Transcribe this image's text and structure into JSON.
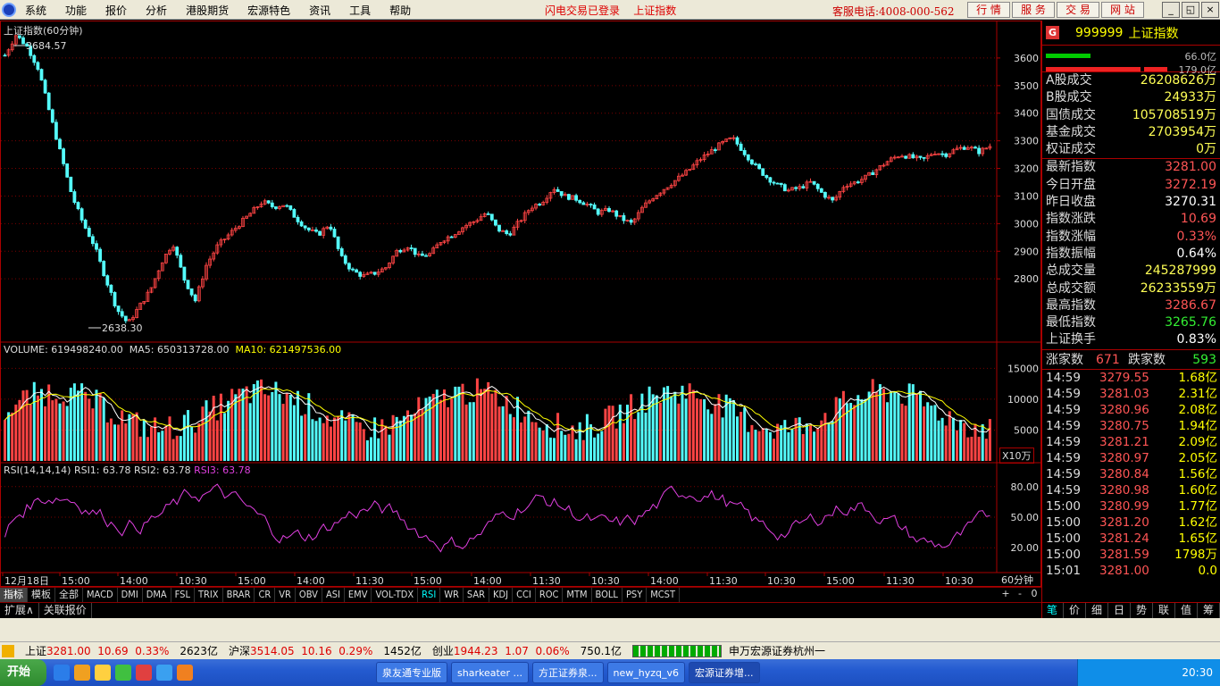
{
  "menubar": {
    "items": [
      "系统",
      "功能",
      "报价",
      "分析",
      "港股期货",
      "宏源特色",
      "资讯",
      "工具",
      "帮助"
    ],
    "status": "闪电交易已登录",
    "index_name": "上证指数",
    "phone": "客服电话:4008-000-562",
    "quick_buttons": [
      "行 情",
      "服 务",
      "交 易",
      "网 站"
    ],
    "window_buttons": [
      "_",
      "◱",
      "×"
    ]
  },
  "chart": {
    "title": "上证指数(60分钟)",
    "high_label": "3684.57",
    "low_label": "2638.30",
    "price_ticks": [
      "3600",
      "3500",
      "3400",
      "3300",
      "3200",
      "3100",
      "3000",
      "2900",
      "2800"
    ],
    "volume_header": "VOLUME: 619498240.00",
    "ma5_header": "MA5: 650313728.00",
    "ma10_header": "MA10: 621497536.00",
    "volume_ticks": [
      "15000",
      "10000",
      "5000"
    ],
    "volume_unit": "X10万",
    "rsi_header": "RSI(14,14,14)",
    "rsi1": "RSI1: 63.78",
    "rsi2": "RSI2: 63.78",
    "rsi3": "RSI3: 63.78",
    "rsi_ticks": [
      "80.00",
      "50.00",
      "20.00"
    ],
    "x_labels": [
      "12月18日",
      "15:00",
      "14:00",
      "10:30",
      "15:00",
      "14:00",
      "11:30",
      "15:00",
      "14:00",
      "11:30",
      "10:30",
      "14:00",
      "11:30",
      "10:30",
      "15:00",
      "11:30",
      "10:30"
    ],
    "period_label": "60分钟",
    "colors": {
      "up": "#ff4444",
      "down": "#54fcfc",
      "ma5": "#ffff00",
      "rsi": "#e040e0",
      "grid": "#7a0000"
    }
  },
  "chart_data": {
    "type": "line",
    "title": "上证指数(60分钟)",
    "ylim": [
      2600,
      3700
    ],
    "series": [
      {
        "name": "上证指数",
        "values": [
          3610,
          3684,
          3640,
          3560,
          3400,
          3250,
          3100,
          3000,
          2920,
          2800,
          2690,
          2638,
          2700,
          2760,
          2860,
          2930,
          2800,
          2720,
          2850,
          2920,
          2960,
          3000,
          3040,
          3080,
          3060,
          3070,
          3020,
          2980,
          2960,
          3000,
          2880,
          2830,
          2810,
          2820,
          2840,
          2900,
          2920,
          2880,
          2890,
          2940,
          2960,
          2990,
          3010,
          3040,
          2980,
          2960,
          3010,
          3060,
          3080,
          3130,
          3100,
          3090,
          3070,
          3040,
          3050,
          3020,
          3000,
          3060,
          3100,
          3130,
          3160,
          3190,
          3230,
          3260,
          3290,
          3310,
          3260,
          3210,
          3170,
          3140,
          3120,
          3130,
          3150,
          3110,
          3080,
          3140,
          3150,
          3170,
          3200,
          3230,
          3250,
          3240,
          3230,
          3260,
          3250,
          3270,
          3280,
          3260,
          3281
        ]
      }
    ],
    "volume_ticks": [
      5000,
      10000,
      15000
    ],
    "rsi_ticks": [
      20,
      50,
      80
    ]
  },
  "right": {
    "badge": "G",
    "code": "999999",
    "name": "上证指数",
    "bar_top": "66.0亿",
    "bar_bottom": "179.0亿",
    "stats1": [
      {
        "k": "A股成交",
        "v": "26208626万",
        "c": "#ffff55"
      },
      {
        "k": "B股成交",
        "v": "24933万",
        "c": "#ffff55"
      },
      {
        "k": "国债成交",
        "v": "105708519万",
        "c": "#ffff55"
      },
      {
        "k": "基金成交",
        "v": "2703954万",
        "c": "#ffff55"
      },
      {
        "k": "权证成交",
        "v": "0万",
        "c": "#ffff55"
      }
    ],
    "stats2": [
      {
        "k": "最新指数",
        "v": "3281.00",
        "c": "#ff5555"
      },
      {
        "k": "今日开盘",
        "v": "3272.19",
        "c": "#ff5555"
      },
      {
        "k": "昨日收盘",
        "v": "3270.31",
        "c": "#ffffff"
      },
      {
        "k": "指数涨跌",
        "v": "10.69",
        "c": "#ff5555"
      },
      {
        "k": "指数涨幅",
        "v": "0.33%",
        "c": "#ff5555"
      },
      {
        "k": "指数振幅",
        "v": "0.64%",
        "c": "#ffffff"
      },
      {
        "k": "总成交量",
        "v": "245287999",
        "c": "#ffff55"
      },
      {
        "k": "总成交额",
        "v": "26233559万",
        "c": "#ffff55"
      },
      {
        "k": "最高指数",
        "v": "3286.67",
        "c": "#ff5555"
      },
      {
        "k": "最低指数",
        "v": "3265.76",
        "c": "#33ee33"
      },
      {
        "k": "上证换手",
        "v": "0.83%",
        "c": "#ffffff"
      }
    ],
    "up_label": "涨家数",
    "up_value": "671",
    "down_label": "跌家数",
    "down_value": "593",
    "ticks": [
      {
        "t": "14:59",
        "p": "3279.55",
        "v": "1.68亿"
      },
      {
        "t": "14:59",
        "p": "3281.03",
        "v": "2.31亿"
      },
      {
        "t": "14:59",
        "p": "3280.96",
        "v": "2.08亿"
      },
      {
        "t": "14:59",
        "p": "3280.75",
        "v": "1.94亿"
      },
      {
        "t": "14:59",
        "p": "3281.21",
        "v": "2.09亿"
      },
      {
        "t": "14:59",
        "p": "3280.97",
        "v": "2.05亿"
      },
      {
        "t": "14:59",
        "p": "3280.84",
        "v": "1.56亿"
      },
      {
        "t": "14:59",
        "p": "3280.98",
        "v": "1.60亿"
      },
      {
        "t": "15:00",
        "p": "3280.99",
        "v": "1.77亿"
      },
      {
        "t": "15:00",
        "p": "3281.20",
        "v": "1.62亿"
      },
      {
        "t": "15:00",
        "p": "3281.24",
        "v": "1.65亿"
      },
      {
        "t": "15:00",
        "p": "3281.59",
        "v": "1798万"
      },
      {
        "t": "15:01",
        "p": "3281.00",
        "v": "0.0"
      }
    ],
    "tabs": [
      "笔",
      "价",
      "细",
      "日",
      "势",
      "联",
      "值",
      "筹"
    ]
  },
  "indicator_tabs": [
    "指标",
    "模板",
    "全部",
    "MACD",
    "DMI",
    "DMA",
    "FSL",
    "TRIX",
    "BRAR",
    "CR",
    "VR",
    "OBV",
    "ASI",
    "EMV",
    "VOL-TDX",
    "RSI",
    "WR",
    "SAR",
    "KDJ",
    "CCI",
    "ROC",
    "MTM",
    "BOLL",
    "PSY",
    "MCST"
  ],
  "zoom_buttons": [
    "+",
    "-",
    "0"
  ],
  "ext_tabs": [
    "扩展∧",
    "关联报价"
  ],
  "statusbar": {
    "sh_label": "上证",
    "sh_price": "3281.00",
    "sh_change": "10.69",
    "sh_pct": "0.33%",
    "sh_amount": "2623亿",
    "hs_label": "沪深",
    "hs_price": "3514.05",
    "hs_change": "10.16",
    "hs_pct": "0.29%",
    "hs_amount": "1452亿",
    "cy_label": "创业",
    "cy_price": "1944.23",
    "cy_change": "1.07",
    "cy_pct": "0.06%",
    "cy_amount": "750.1亿",
    "broker": "申万宏源证券杭州一"
  },
  "taskbar": {
    "start": "开始",
    "windows": [
      "泉友通专业版",
      "sharkeater ...",
      "方正证券泉...",
      "new_hyzq_v6",
      "宏源证券增..."
    ],
    "clock": "20:30"
  }
}
